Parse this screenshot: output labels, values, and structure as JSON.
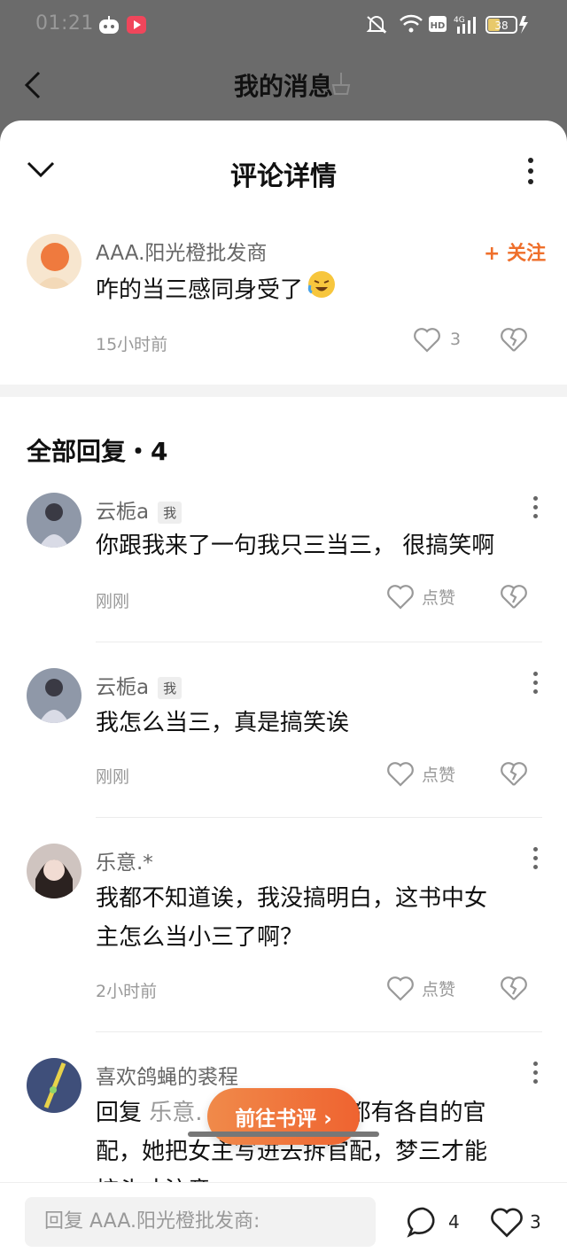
{
  "status_bar": {
    "time": "01:21",
    "battery": "38"
  },
  "header": {
    "title": "我的消息",
    "back_icon": "chevron-left-icon",
    "clean_icon": "broom-icon"
  },
  "sheet": {
    "title": "评论详情"
  },
  "main_comment": {
    "author": "AAA.阳光橙批发商",
    "follow_label": "+ 关注",
    "content": "咋的当三感同身受了",
    "time": "15小时前",
    "like_count": "3"
  },
  "replies_header": "全部回复・4",
  "replies": [
    {
      "author": "云栀a",
      "tag": "我",
      "content": "你跟我来了一句我只三当三，  很搞笑啊",
      "time": "刚刚",
      "like_label": "点赞"
    },
    {
      "author": "云栀a",
      "tag": "我",
      "content": "我怎么当三，真是搞笑诶",
      "time": "刚刚",
      "like_label": "点赞"
    },
    {
      "author": "乐意.*",
      "tag": "",
      "content_line1": "我都不知道诶，我没搞明白，这书中女",
      "content_line2": "主怎么当小三了啊？",
      "time": "2小时前",
      "like_label": "点赞"
    },
    {
      "author": "喜欢鸽蝇的裘程",
      "tag": "",
      "content_prefix": "回复",
      "reply_to": "乐意.",
      "content_line1_rest": "都有各自的官",
      "content_line2": "配，她把女主写进去拆官配，梦三才能",
      "content_line3": "棕头才注意"
    }
  ],
  "floating_button": "前往书评 ›",
  "bottom_bar": {
    "input_placeholder": "回复 AAA.阳光橙批发商:",
    "comment_count": "4",
    "like_count": "3"
  },
  "colors": {
    "accent": "#ef6f2b",
    "overlay": "#6b6b6b"
  }
}
